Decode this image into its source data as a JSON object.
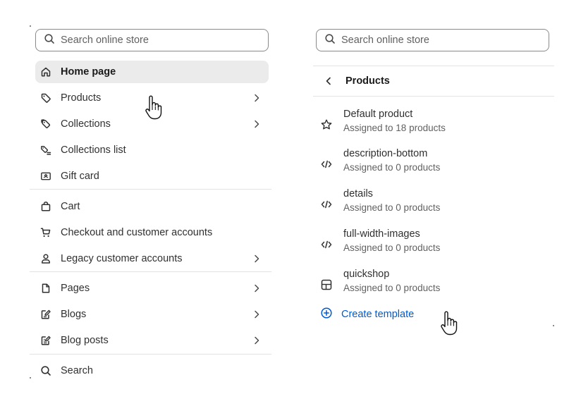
{
  "left_panel": {
    "search": {
      "placeholder": "Search online store",
      "icon": "search-icon"
    },
    "items": [
      {
        "label": "Home page",
        "icon": "home-icon",
        "active": true,
        "has_submenu": false
      },
      {
        "label": "Products",
        "icon": "tag-icon",
        "has_submenu": true
      },
      {
        "label": "Collections",
        "icon": "collection-tag-icon",
        "has_submenu": true
      },
      {
        "label": "Collections list",
        "icon": "collection-list-icon",
        "has_submenu": false
      },
      {
        "label": "Gift card",
        "icon": "gift-card-icon",
        "has_submenu": false
      },
      {
        "label": "Cart",
        "icon": "bag-icon",
        "has_submenu": false
      },
      {
        "label": "Checkout and customer accounts",
        "icon": "cart-icon",
        "has_submenu": false
      },
      {
        "label": "Legacy customer accounts",
        "icon": "person-icon",
        "has_submenu": true
      },
      {
        "label": "Pages",
        "icon": "page-icon",
        "has_submenu": true
      },
      {
        "label": "Blogs",
        "icon": "blog-icon",
        "has_submenu": true
      },
      {
        "label": "Blog posts",
        "icon": "blog-post-icon",
        "has_submenu": true
      },
      {
        "label": "Search",
        "icon": "search-icon",
        "has_submenu": false
      }
    ]
  },
  "right_panel": {
    "search": {
      "placeholder": "Search online store",
      "icon": "search-icon"
    },
    "header": {
      "title": "Products",
      "back_icon": "chevron-left-icon"
    },
    "templates": [
      {
        "name": "Default product",
        "assigned": "Assigned to 18 products",
        "icon": "star-icon"
      },
      {
        "name": "description-bottom",
        "assigned": "Assigned to 0 products",
        "icon": "code-icon"
      },
      {
        "name": "details",
        "assigned": "Assigned to 0 products",
        "icon": "code-icon"
      },
      {
        "name": "full-width-images",
        "assigned": "Assigned to 0 products",
        "icon": "code-icon"
      },
      {
        "name": "quickshop",
        "assigned": "Assigned to 0 products",
        "icon": "layout-icon"
      }
    ],
    "create_template": {
      "label": "Create template",
      "icon": "plus-circle-icon"
    }
  },
  "colors": {
    "active_row": "#ebebeb",
    "link": "#005bd3",
    "divider": "#e3e3e3",
    "text": "#303030"
  }
}
